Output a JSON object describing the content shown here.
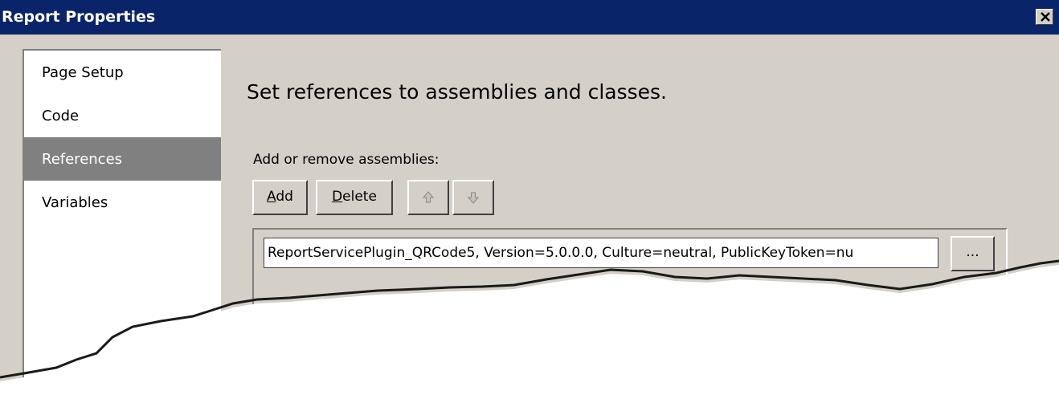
{
  "window": {
    "title": "Report Properties",
    "close_icon": "close-icon"
  },
  "nav": {
    "items": [
      {
        "label": "Page Setup",
        "selected": false
      },
      {
        "label": "Code",
        "selected": false
      },
      {
        "label": "References",
        "selected": true
      },
      {
        "label": "Variables",
        "selected": false
      }
    ]
  },
  "main": {
    "heading": "Set references to assemblies and classes.",
    "assemblies_label": "Add or remove assemblies:",
    "add_label_u": "A",
    "add_label_rest": "dd",
    "delete_label_u": "D",
    "delete_label_rest": "elete",
    "move_up_icon": "arrow-up-icon",
    "move_down_icon": "arrow-down-icon",
    "assembly_reference": "ReportServicePlugin_QRCode5, Version=5.0.0.0, Culture=neutral, PublicKeyToken=nu",
    "browse_label": "..."
  },
  "colors": {
    "titlebar": "#0a246a",
    "face": "#d4d0c8",
    "selection": "#808080"
  }
}
